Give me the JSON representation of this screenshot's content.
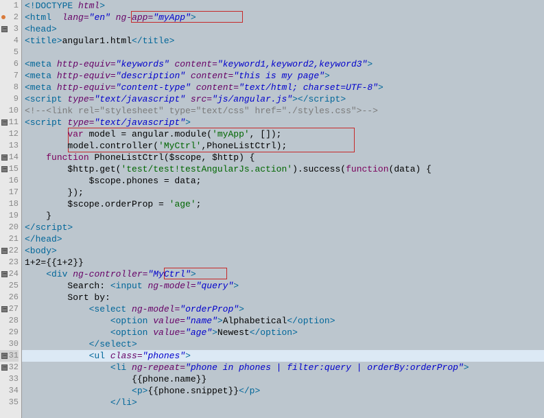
{
  "lines": [
    {
      "num": 1,
      "marker": "",
      "segments": [
        {
          "t": "<!",
          "c": "tag"
        },
        {
          "t": "DOCTYPE",
          "c": "tag"
        },
        {
          "t": " html",
          "c": "attr-name"
        },
        {
          "t": ">",
          "c": "tag"
        }
      ]
    },
    {
      "num": 2,
      "marker": "dot",
      "segments": [
        {
          "t": "<html",
          "c": "tag"
        },
        {
          "t": "  ",
          "c": ""
        },
        {
          "t": "lang=",
          "c": "attr-name"
        },
        {
          "t": "\"en\"",
          "c": "attr-val"
        },
        {
          "t": " ",
          "c": ""
        },
        {
          "t": "ng-app=",
          "c": "attr-name"
        },
        {
          "t": "\"myApp\"",
          "c": "attr-val"
        },
        {
          "t": ">",
          "c": "tag"
        }
      ]
    },
    {
      "num": 3,
      "marker": "minus",
      "segments": [
        {
          "t": "<head>",
          "c": "tag"
        }
      ]
    },
    {
      "num": 4,
      "marker": "",
      "segments": [
        {
          "t": "<title>",
          "c": "tag"
        },
        {
          "t": "angular1.html",
          "c": "text-content"
        },
        {
          "t": "</title>",
          "c": "tag"
        }
      ]
    },
    {
      "num": 5,
      "marker": "",
      "segments": []
    },
    {
      "num": 6,
      "marker": "",
      "segments": [
        {
          "t": "<meta",
          "c": "tag"
        },
        {
          "t": " ",
          "c": ""
        },
        {
          "t": "http-equiv=",
          "c": "attr-name"
        },
        {
          "t": "\"keywords\"",
          "c": "attr-val"
        },
        {
          "t": " ",
          "c": ""
        },
        {
          "t": "content=",
          "c": "attr-name"
        },
        {
          "t": "\"keyword1,keyword2,keyword3\"",
          "c": "attr-val"
        },
        {
          "t": ">",
          "c": "tag"
        }
      ]
    },
    {
      "num": 7,
      "marker": "",
      "segments": [
        {
          "t": "<meta",
          "c": "tag"
        },
        {
          "t": " ",
          "c": ""
        },
        {
          "t": "http-equiv=",
          "c": "attr-name"
        },
        {
          "t": "\"description\"",
          "c": "attr-val"
        },
        {
          "t": " ",
          "c": ""
        },
        {
          "t": "content=",
          "c": "attr-name"
        },
        {
          "t": "\"this is my page\"",
          "c": "attr-val"
        },
        {
          "t": ">",
          "c": "tag"
        }
      ]
    },
    {
      "num": 8,
      "marker": "",
      "segments": [
        {
          "t": "<meta",
          "c": "tag"
        },
        {
          "t": " ",
          "c": ""
        },
        {
          "t": "http-equiv=",
          "c": "attr-name"
        },
        {
          "t": "\"content-type\"",
          "c": "attr-val"
        },
        {
          "t": " ",
          "c": ""
        },
        {
          "t": "content=",
          "c": "attr-name"
        },
        {
          "t": "\"text/html; charset=UTF-8\"",
          "c": "attr-val"
        },
        {
          "t": ">",
          "c": "tag"
        }
      ]
    },
    {
      "num": 9,
      "marker": "",
      "segments": [
        {
          "t": "<script",
          "c": "tag"
        },
        {
          "t": " ",
          "c": ""
        },
        {
          "t": "type=",
          "c": "attr-name"
        },
        {
          "t": "\"text/javascript\"",
          "c": "attr-val"
        },
        {
          "t": " ",
          "c": ""
        },
        {
          "t": "src=",
          "c": "attr-name"
        },
        {
          "t": "\"js/angular.js\"",
          "c": "attr-val"
        },
        {
          "t": "></​script>",
          "c": "tag"
        }
      ]
    },
    {
      "num": 10,
      "marker": "",
      "segments": [
        {
          "t": "<!--<link rel=\"stylesheet\" type=\"text/css\" href=\"./styles.css\">-->",
          "c": "comment"
        }
      ]
    },
    {
      "num": 11,
      "marker": "minus",
      "segments": [
        {
          "t": "<script",
          "c": "tag"
        },
        {
          "t": " ",
          "c": ""
        },
        {
          "t": "type=",
          "c": "attr-name"
        },
        {
          "t": "\"text/javascript\"",
          "c": "attr-val"
        },
        {
          "t": ">",
          "c": "tag"
        }
      ]
    },
    {
      "num": 12,
      "marker": "",
      "segments": [
        {
          "t": "        ",
          "c": ""
        },
        {
          "t": "var",
          "c": "keyword"
        },
        {
          "t": " model = angular.module(",
          "c": "text-content"
        },
        {
          "t": "'myApp'",
          "c": "string"
        },
        {
          "t": ", []);",
          "c": "text-content"
        }
      ]
    },
    {
      "num": 13,
      "marker": "",
      "segments": [
        {
          "t": "        model.controller(",
          "c": "text-content"
        },
        {
          "t": "'MyCtrl'",
          "c": "string"
        },
        {
          "t": ",PhoneListCtrl);",
          "c": "text-content"
        }
      ]
    },
    {
      "num": 14,
      "marker": "minus",
      "segments": [
        {
          "t": "    ",
          "c": ""
        },
        {
          "t": "function",
          "c": "keyword"
        },
        {
          "t": " PhoneListCtrl($scope, $http) {",
          "c": "text-content"
        }
      ]
    },
    {
      "num": 15,
      "marker": "minus",
      "segments": [
        {
          "t": "        $http.get(",
          "c": "text-content"
        },
        {
          "t": "'test/test!testAngularJs.action'",
          "c": "string"
        },
        {
          "t": ").success(",
          "c": "text-content"
        },
        {
          "t": "function",
          "c": "keyword"
        },
        {
          "t": "(data) {",
          "c": "text-content"
        }
      ]
    },
    {
      "num": 16,
      "marker": "",
      "segments": [
        {
          "t": "            $scope.phones = data;",
          "c": "text-content"
        }
      ]
    },
    {
      "num": 17,
      "marker": "",
      "segments": [
        {
          "t": "        });",
          "c": "text-content"
        }
      ]
    },
    {
      "num": 18,
      "marker": "",
      "segments": [
        {
          "t": "        $scope.orderProp = ",
          "c": "text-content"
        },
        {
          "t": "'age'",
          "c": "string"
        },
        {
          "t": ";",
          "c": "text-content"
        }
      ]
    },
    {
      "num": 19,
      "marker": "",
      "segments": [
        {
          "t": "    }",
          "c": "text-content"
        }
      ]
    },
    {
      "num": 20,
      "marker": "",
      "segments": [
        {
          "t": "</​script>",
          "c": "tag"
        }
      ]
    },
    {
      "num": 21,
      "marker": "",
      "segments": [
        {
          "t": "</head>",
          "c": "tag"
        }
      ]
    },
    {
      "num": 22,
      "marker": "minus",
      "segments": [
        {
          "t": "<body>",
          "c": "tag"
        }
      ]
    },
    {
      "num": 23,
      "marker": "",
      "segments": [
        {
          "t": "1+2={{1+2}}",
          "c": "text-content"
        }
      ]
    },
    {
      "num": 24,
      "marker": "minus",
      "segments": [
        {
          "t": "    ",
          "c": ""
        },
        {
          "t": "<div",
          "c": "tag"
        },
        {
          "t": " ",
          "c": ""
        },
        {
          "t": "ng-controller=",
          "c": "attr-name"
        },
        {
          "t": "\"MyCtrl\"",
          "c": "attr-val"
        },
        {
          "t": ">",
          "c": "tag"
        }
      ]
    },
    {
      "num": 25,
      "marker": "",
      "segments": [
        {
          "t": "        Search: ",
          "c": "text-content"
        },
        {
          "t": "<input",
          "c": "tag"
        },
        {
          "t": " ",
          "c": ""
        },
        {
          "t": "ng-model=",
          "c": "attr-name"
        },
        {
          "t": "\"query\"",
          "c": "attr-val"
        },
        {
          "t": ">",
          "c": "tag"
        }
      ]
    },
    {
      "num": 26,
      "marker": "",
      "segments": [
        {
          "t": "        Sort by:",
          "c": "text-content"
        }
      ]
    },
    {
      "num": 27,
      "marker": "minus",
      "segments": [
        {
          "t": "            ",
          "c": ""
        },
        {
          "t": "<select",
          "c": "tag"
        },
        {
          "t": " ",
          "c": ""
        },
        {
          "t": "ng-model=",
          "c": "attr-name"
        },
        {
          "t": "\"orderProp\"",
          "c": "attr-val"
        },
        {
          "t": ">",
          "c": "tag"
        }
      ]
    },
    {
      "num": 28,
      "marker": "",
      "segments": [
        {
          "t": "                ",
          "c": ""
        },
        {
          "t": "<option",
          "c": "tag"
        },
        {
          "t": " ",
          "c": ""
        },
        {
          "t": "value=",
          "c": "attr-name"
        },
        {
          "t": "\"name\"",
          "c": "attr-val"
        },
        {
          "t": ">",
          "c": "tag"
        },
        {
          "t": "Alphabetical",
          "c": "text-content"
        },
        {
          "t": "</option>",
          "c": "tag"
        }
      ]
    },
    {
      "num": 29,
      "marker": "",
      "segments": [
        {
          "t": "                ",
          "c": ""
        },
        {
          "t": "<option",
          "c": "tag"
        },
        {
          "t": " ",
          "c": ""
        },
        {
          "t": "value=",
          "c": "attr-name"
        },
        {
          "t": "\"age\"",
          "c": "attr-val"
        },
        {
          "t": ">",
          "c": "tag"
        },
        {
          "t": "Newest",
          "c": "text-content"
        },
        {
          "t": "</option>",
          "c": "tag"
        }
      ]
    },
    {
      "num": 30,
      "marker": "",
      "segments": [
        {
          "t": "            ",
          "c": ""
        },
        {
          "t": "</select>",
          "c": "tag"
        }
      ]
    },
    {
      "num": 31,
      "marker": "minus",
      "current": true,
      "segments": [
        {
          "t": "            ",
          "c": ""
        },
        {
          "t": "<ul",
          "c": "tag"
        },
        {
          "t": " ",
          "c": ""
        },
        {
          "t": "class=",
          "c": "attr-name"
        },
        {
          "t": "\"phones\"",
          "c": "attr-val"
        },
        {
          "t": ">",
          "c": "tag"
        }
      ]
    },
    {
      "num": 32,
      "marker": "minus",
      "segments": [
        {
          "t": "                ",
          "c": ""
        },
        {
          "t": "<li",
          "c": "tag"
        },
        {
          "t": " ",
          "c": ""
        },
        {
          "t": "ng-repeat=",
          "c": "attr-name"
        },
        {
          "t": "\"phone in phones | filter:query | orderBy:orderProp\"",
          "c": "attr-val"
        },
        {
          "t": ">",
          "c": "tag"
        }
      ]
    },
    {
      "num": 33,
      "marker": "",
      "segments": [
        {
          "t": "                    {{phone.name}}",
          "c": "text-content"
        }
      ]
    },
    {
      "num": 34,
      "marker": "",
      "segments": [
        {
          "t": "                    ",
          "c": ""
        },
        {
          "t": "<p>",
          "c": "tag"
        },
        {
          "t": "{{phone.snippet}}",
          "c": "text-content"
        },
        {
          "t": "</p>",
          "c": "tag"
        }
      ]
    },
    {
      "num": 35,
      "marker": "",
      "segments": [
        {
          "t": "                ",
          "c": ""
        },
        {
          "t": "</li>",
          "c": "tag"
        }
      ]
    }
  ]
}
